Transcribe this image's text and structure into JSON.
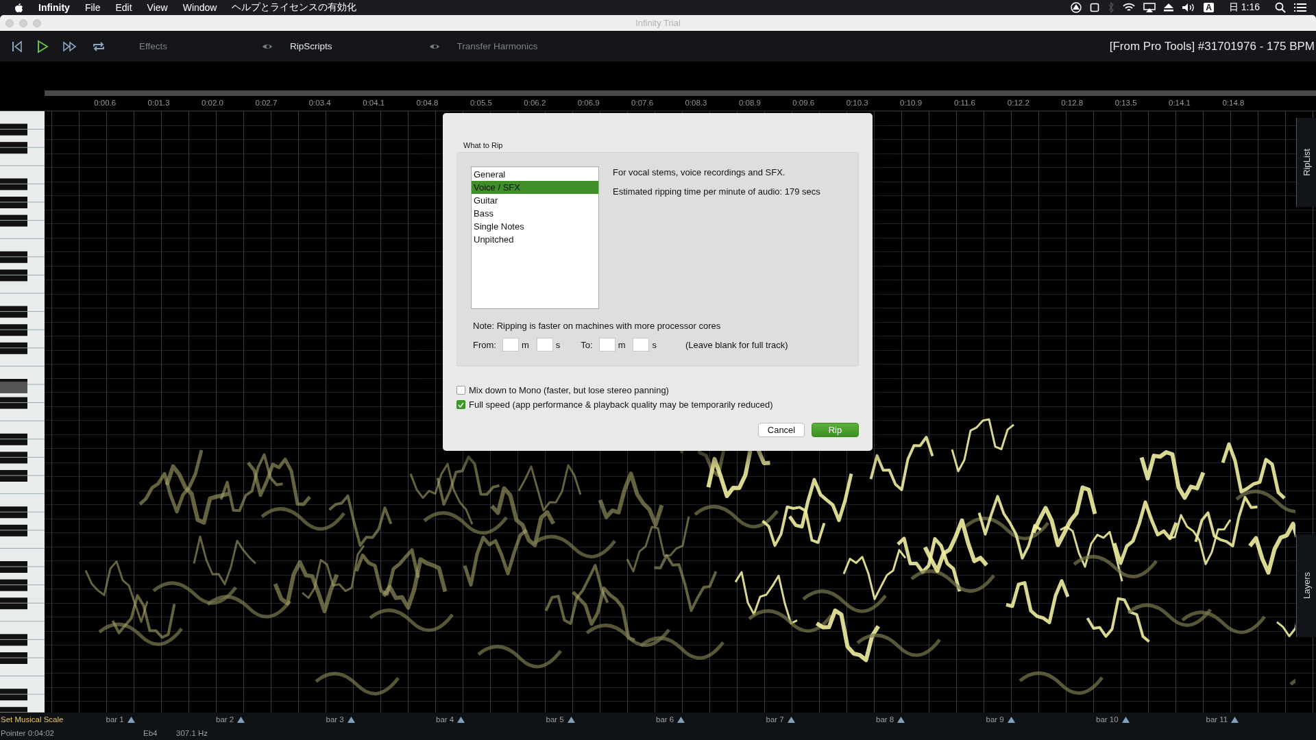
{
  "menu_bar": {
    "app": "Infinity",
    "items": [
      "File",
      "Edit",
      "View",
      "Window",
      "ヘルプとライセンスの有効化"
    ],
    "input_source": "A",
    "clock": "日 1:16"
  },
  "window": {
    "title": "Infinity Trial"
  },
  "toolbar": {
    "tabs": [
      {
        "label": "Effects",
        "selected": false
      },
      {
        "label": "RipScripts",
        "selected": true
      },
      {
        "label": "Transfer Harmonics",
        "selected": false
      }
    ],
    "session": "[From Pro Tools] #31701976 - 175 BPM"
  },
  "ruler": {
    "times": [
      "0:00.6",
      "0:01.3",
      "0:02.0",
      "0:02.7",
      "0:03.4",
      "0:04.1",
      "0:04.8",
      "0:05.5",
      "0:06.2",
      "0:06.9",
      "0:07.6",
      "0:08.3",
      "0:08.9",
      "0:09.6",
      "0:10.3",
      "0:10.9",
      "0:11.6",
      "0:12.2",
      "0:12.8",
      "0:13.5",
      "0:14.1",
      "0:14.8"
    ]
  },
  "side_tabs": [
    "RipList",
    "Layers"
  ],
  "status": {
    "scale_button": "Set Musical Scale",
    "bars": [
      "bar 1",
      "bar 2",
      "bar 3",
      "bar 4",
      "bar 5",
      "bar 6",
      "bar 7",
      "bar 8",
      "bar 9",
      "bar 10",
      "bar 11"
    ],
    "pointer": "Pointer 0:04:02",
    "note": "Eb4",
    "frequency": "307.1 Hz"
  },
  "dialog": {
    "group_title": "What to Rip",
    "presets": [
      {
        "label": "General",
        "selected": false
      },
      {
        "label": "Voice / SFX",
        "selected": true
      },
      {
        "label": "Guitar",
        "selected": false
      },
      {
        "label": "Bass",
        "selected": false
      },
      {
        "label": "Single Notes",
        "selected": false
      },
      {
        "label": "Unpitched",
        "selected": false
      }
    ],
    "description": "For vocal stems, voice recordings and SFX.",
    "estimate": "Estimated ripping time per minute of audio: 179 secs",
    "note": "Note: Ripping is faster on machines with more processor cores",
    "range": {
      "from": {
        "label": "From:",
        "units": [
          "m",
          "s"
        ]
      },
      "to": {
        "label": "To:",
        "units": [
          "m",
          "s"
        ]
      },
      "hint": "(Leave blank for full track)"
    },
    "options": [
      {
        "label": "Mix down to Mono (faster, but lose stereo panning)",
        "checked": false
      },
      {
        "label": "Full speed (app performance & playback quality may be temporarily reduced)",
        "checked": true
      }
    ],
    "buttons": [
      {
        "label": "Cancel",
        "kind": "secondary"
      },
      {
        "label": "Rip",
        "kind": "primary"
      }
    ]
  }
}
